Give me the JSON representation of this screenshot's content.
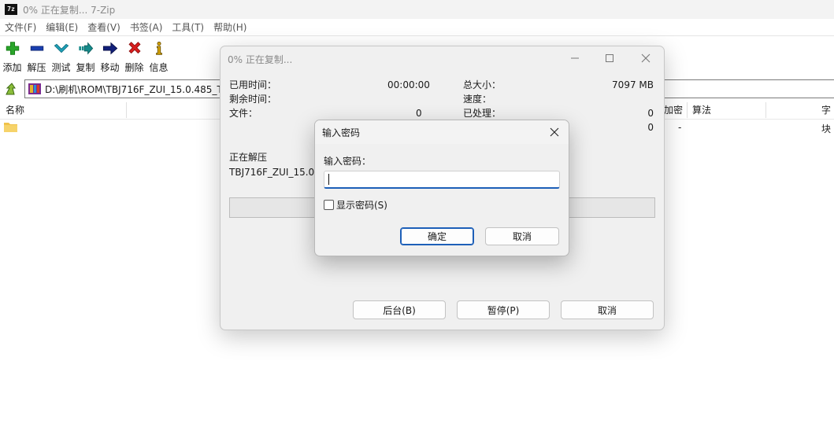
{
  "main_window": {
    "title": "0% 正在复制... 7-Zip",
    "logo_text": "7z"
  },
  "menu": [
    {
      "label": "文件(F)"
    },
    {
      "label": "编辑(E)"
    },
    {
      "label": "查看(V)"
    },
    {
      "label": "书签(A)"
    },
    {
      "label": "工具(T)"
    },
    {
      "label": "帮助(H)"
    }
  ],
  "toolbar": [
    {
      "label": "添加",
      "icon": "plus-icon",
      "color": "#2aa52a"
    },
    {
      "label": "解压",
      "icon": "minus-icon",
      "color": "#1a3fb0"
    },
    {
      "label": "测试",
      "icon": "check-icon",
      "color": "#1fa0b8"
    },
    {
      "label": "复制",
      "icon": "copy-arrow-icon",
      "color": "#158a8a"
    },
    {
      "label": "移动",
      "icon": "move-arrow-icon",
      "color": "#12207a"
    },
    {
      "label": "删除",
      "icon": "delete-x-icon",
      "color": "#d81e1e"
    },
    {
      "label": "信息",
      "icon": "info-icon",
      "color": "#d6a400"
    }
  ],
  "address": {
    "path": "D:\\刷机\\ROM\\TBJ716F_ZUI_15.0.485_To"
  },
  "list": {
    "columns": [
      {
        "label": "名称"
      },
      {
        "label": "加密"
      },
      {
        "label": "算法"
      },
      {
        "label": "字块"
      }
    ],
    "rows": [
      {
        "encrypted": "-"
      }
    ]
  },
  "progress_dialog": {
    "title": "0% 正在复制...",
    "elapsed_label": "已用时间：",
    "elapsed_value": "00:00:00",
    "remaining_label": "剩余时间：",
    "files_label": "文件：",
    "files_value": "0",
    "total_size_label": "总大小：",
    "total_size_value": "7097 MB",
    "speed_label": "速度：",
    "processed_label": "已处理：",
    "processed_value": "0",
    "compressed_value": "0",
    "status_label": "正在解压",
    "current_file": "TBJ716F_ZUI_15.0.48",
    "progress_percent": 0,
    "background_button": "后台(B)",
    "pause_button": "暂停(P)",
    "cancel_button": "取消"
  },
  "password_dialog": {
    "title": "输入密码",
    "prompt_label": "输入密码：",
    "password_value": "",
    "show_password_label": "显示密码(S)",
    "show_password_checked": false,
    "ok_button": "确定",
    "cancel_button": "取消"
  }
}
